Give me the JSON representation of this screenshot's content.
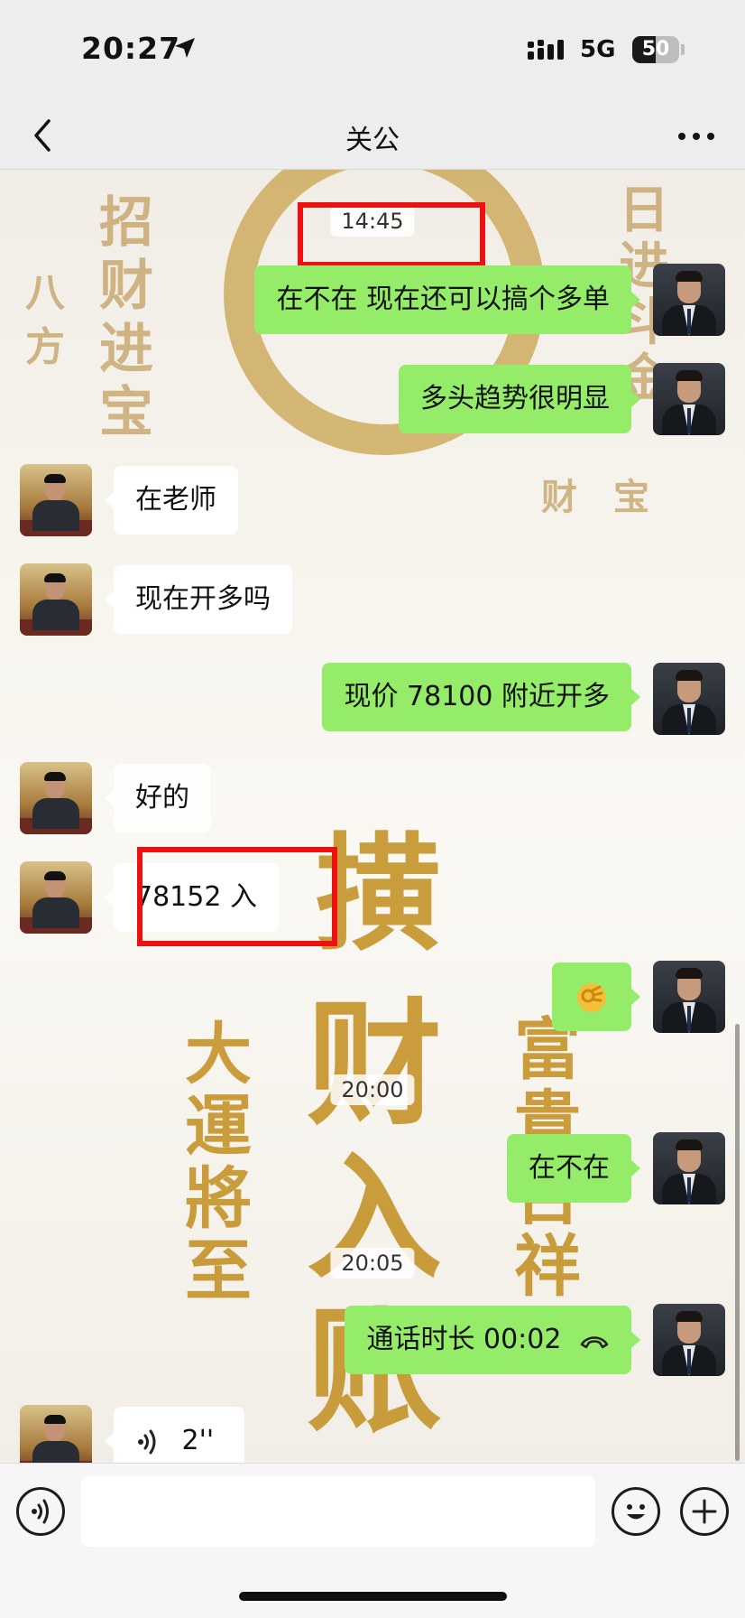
{
  "status_bar": {
    "time": "20:27",
    "network": "5G",
    "battery": "50",
    "battery_level": 0.5
  },
  "nav": {
    "title": "关公",
    "back_icon": "chevron-left-icon",
    "more_icon": "more-dots-icon"
  },
  "background_art": {
    "glyphs": [
      "招",
      "财",
      "进",
      "宝",
      "八",
      "方",
      "日",
      "进",
      "斗",
      "金",
      "财",
      "宝",
      "撗",
      "财",
      "入",
      "账",
      "大",
      "運",
      "將",
      "至",
      "富",
      "貴",
      "吉",
      "祥"
    ]
  },
  "timestamps": [
    "14:45",
    "20:00",
    "20:05"
  ],
  "messages": [
    {
      "from": "me",
      "text": "在不在  现在还可以搞个多单"
    },
    {
      "from": "me",
      "text": "多头趋势很明显"
    },
    {
      "from": "other",
      "text": "在老师"
    },
    {
      "from": "other",
      "text": "现在开多吗"
    },
    {
      "from": "me",
      "text": "现价 78100 附近开多"
    },
    {
      "from": "other",
      "text": "好的"
    },
    {
      "from": "other",
      "text": "78152 入"
    },
    {
      "from": "me",
      "text": "",
      "emoji": "ok-hand-emoji"
    },
    {
      "from": "me",
      "text": "在不在"
    },
    {
      "from": "me",
      "text": "通话时长 00:02",
      "icon": "hang-up-icon"
    },
    {
      "from": "other",
      "text": "2''",
      "icon": "voice-wave-icon"
    }
  ],
  "input_bar": {
    "voice_icon": "voice-icon",
    "emoji_icon": "emoji-icon",
    "add_icon": "plus-icon",
    "placeholder": ""
  },
  "colors": {
    "my_bubble": "#95ec69",
    "other_bubble": "#ffffff",
    "highlight": "#ee1111",
    "gold": "#c49228"
  }
}
